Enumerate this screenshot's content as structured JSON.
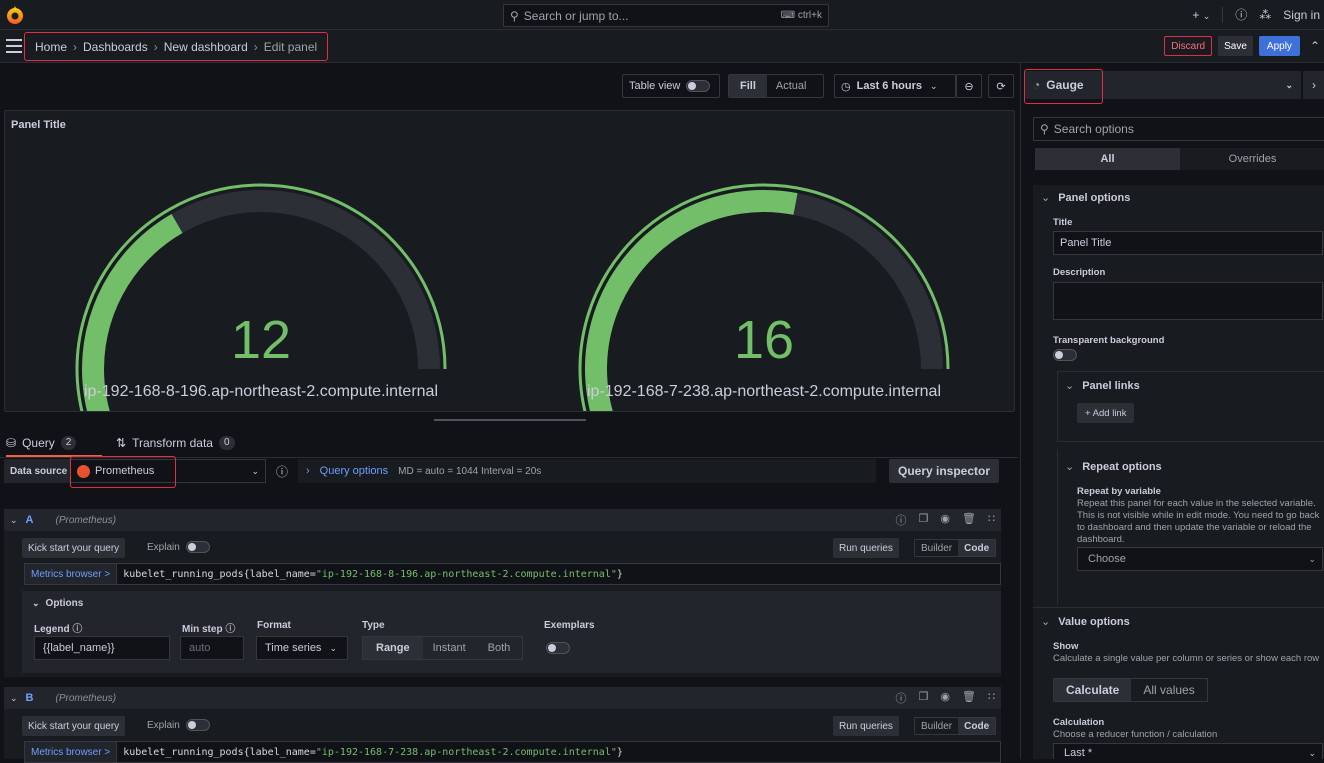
{
  "topbar": {
    "search_placeholder": "Search or jump to...",
    "search_shortcut": "ctrl+k",
    "plus": "+",
    "sign_in": "Sign in"
  },
  "breadcrumb": {
    "items": [
      "Home",
      "Dashboards",
      "New dashboard",
      "Edit panel"
    ]
  },
  "actions": {
    "discard": "Discard",
    "save": "Save",
    "apply": "Apply"
  },
  "toolbar": {
    "table_view": "Table view",
    "fill": "Fill",
    "actual": "Actual",
    "time_range": "Last 6 hours"
  },
  "panel": {
    "title": "Panel Title",
    "gauges": [
      {
        "value": "12",
        "label": "ip-192-168-8-196.ap-northeast-2.compute.internal",
        "fill_fraction": 0.5
      },
      {
        "value": "16",
        "label": "ip-192-168-7-238.ap-northeast-2.compute.internal",
        "fill_fraction": 0.67
      }
    ],
    "gauge_color": "#73bf69",
    "track_color": "#2c3036"
  },
  "query_tabs": {
    "query": "Query",
    "query_count": "2",
    "transform": "Transform data",
    "transform_count": "0"
  },
  "datasource": {
    "label": "Data source",
    "value": "Prometheus",
    "query_options": "Query options",
    "query_meta": "MD = auto = 1044   Interval = 20s",
    "inspector": "Query inspector"
  },
  "queries": [
    {
      "name": "A",
      "ds": "(Prometheus)",
      "kick": "Kick start your query",
      "explain": "Explain",
      "run": "Run queries",
      "builder": "Builder",
      "code": "Code",
      "metrics_browser": "Metrics browser >",
      "expr_prefix": "kubelet_running_pods{label_name=",
      "expr_str": "\"ip-192-168-8-196.ap-northeast-2.compute.internal\"",
      "expr_suffix": "}"
    },
    {
      "name": "B",
      "ds": "(Prometheus)",
      "kick": "Kick start your query",
      "explain": "Explain",
      "run": "Run queries",
      "builder": "Builder",
      "code": "Code",
      "metrics_browser": "Metrics browser >",
      "expr_prefix": "kubelet_running_pods{label_name=",
      "expr_str": "\"ip-192-168-7-238.ap-northeast-2.compute.internal\"",
      "expr_suffix": "}"
    }
  ],
  "options": {
    "title": "Options",
    "legend_label": "Legend",
    "legend_value": "{{label_name}}",
    "minstep_label": "Min step",
    "minstep_placeholder": "auto",
    "format_label": "Format",
    "format_value": "Time series",
    "type_label": "Type",
    "type_options": [
      "Range",
      "Instant",
      "Both"
    ],
    "exemplars_label": "Exemplars"
  },
  "right": {
    "visualization": "Gauge",
    "search_placeholder": "Search options",
    "tab_all": "All",
    "tab_overrides": "Overrides",
    "panel_options": "Panel options",
    "title_label": "Title",
    "title_value": "Panel Title",
    "description_label": "Description",
    "transparent_label": "Transparent background",
    "panel_links": "Panel links",
    "add_link": "+ Add link",
    "repeat_options": "Repeat options",
    "repeat_by_label": "Repeat by variable",
    "repeat_desc": "Repeat this panel for each value in the selected variable. This is not visible while in edit mode. You need to go back to dashboard and then update the variable or reload the dashboard.",
    "choose": "Choose",
    "value_options": "Value options",
    "show_label": "Show",
    "show_desc": "Calculate a single value per column or series or show each row",
    "calculate": "Calculate",
    "all_values": "All values",
    "calc_label": "Calculation",
    "calc_desc": "Choose a reducer function / calculation",
    "calc_value": "Last *"
  }
}
